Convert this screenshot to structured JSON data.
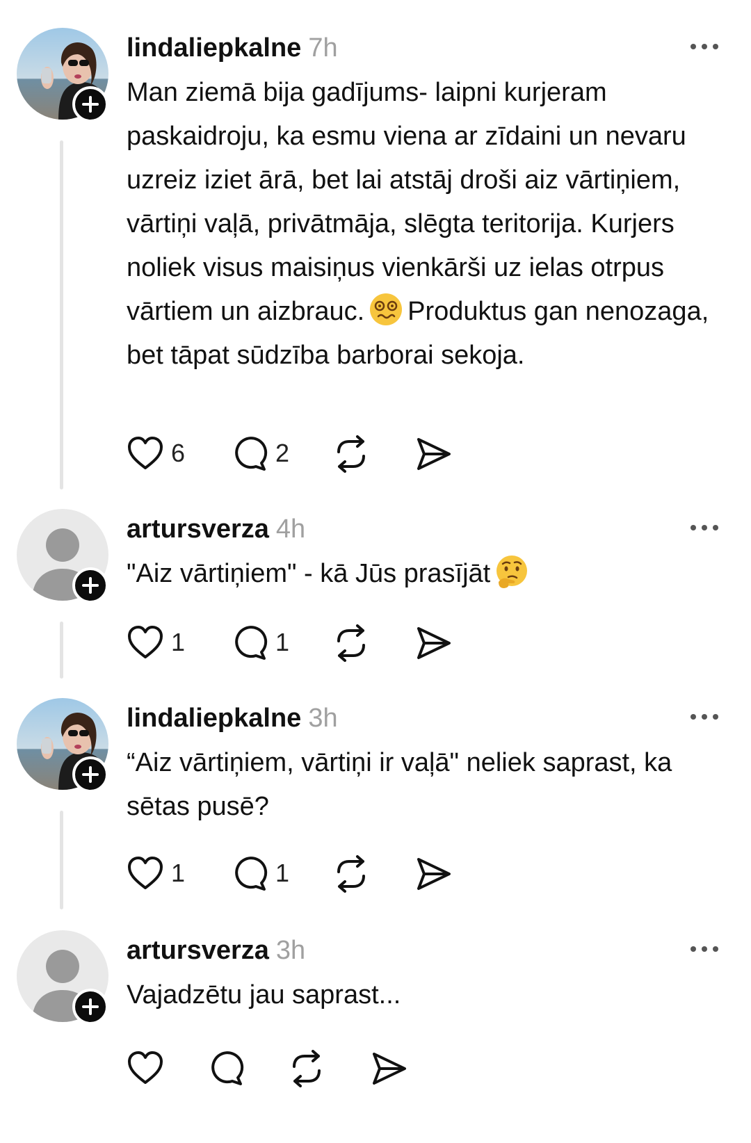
{
  "posts": [
    {
      "username": "lindaliepkalne",
      "time": "7h",
      "avatar": "photo-avatar",
      "text": "Man ziemā bija gadījums- laipni kurjeram paskaidroju, ka esmu viena ar zīdaini un nevaru uzreiz iziet ārā, bet lai atstāj droši aiz vārtiņiem, vārtiņi vaļā, privātmāja, slēgta teritorija. Kurjers noliek visus maisiņus vienkārši uz ielas otrpus vārtiem un aizbrauc.",
      "text_emoji": "woozy-face-emoji",
      "text_after": "Produktus gan nenozaga, bet tāpat sūdzība barborai sekoja.",
      "likes": "6",
      "replies": "2"
    },
    {
      "username": "artursverza",
      "time": "4h",
      "avatar": "default-avatar",
      "text": "\"Aiz vārtiņiem\" - kā Jūs prasījāt",
      "text_emoji": "thinking-face-emoji",
      "likes": "1",
      "replies": "1"
    },
    {
      "username": "lindaliepkalne",
      "time": "3h",
      "avatar": "photo-avatar",
      "text": "“Aiz vārtiņiem, vārtiņi ir vaļā\" neliek saprast, ka sētas pusē?",
      "likes": "1",
      "replies": "1"
    },
    {
      "username": "artursverza",
      "time": "3h",
      "avatar": "default-avatar",
      "text": "Vajadzētu jau saprast...",
      "likes": "",
      "replies": ""
    }
  ],
  "icons": {
    "like": "heart-icon",
    "reply": "comment-icon",
    "repost": "repost-icon",
    "share": "send-icon",
    "more": "more-options-icon",
    "follow": "plus-icon"
  },
  "colors": {
    "text": "#111111",
    "timestamp": "#a0a0a0",
    "thread_line": "#e4e4e4",
    "badge": "#0c0c0c"
  }
}
